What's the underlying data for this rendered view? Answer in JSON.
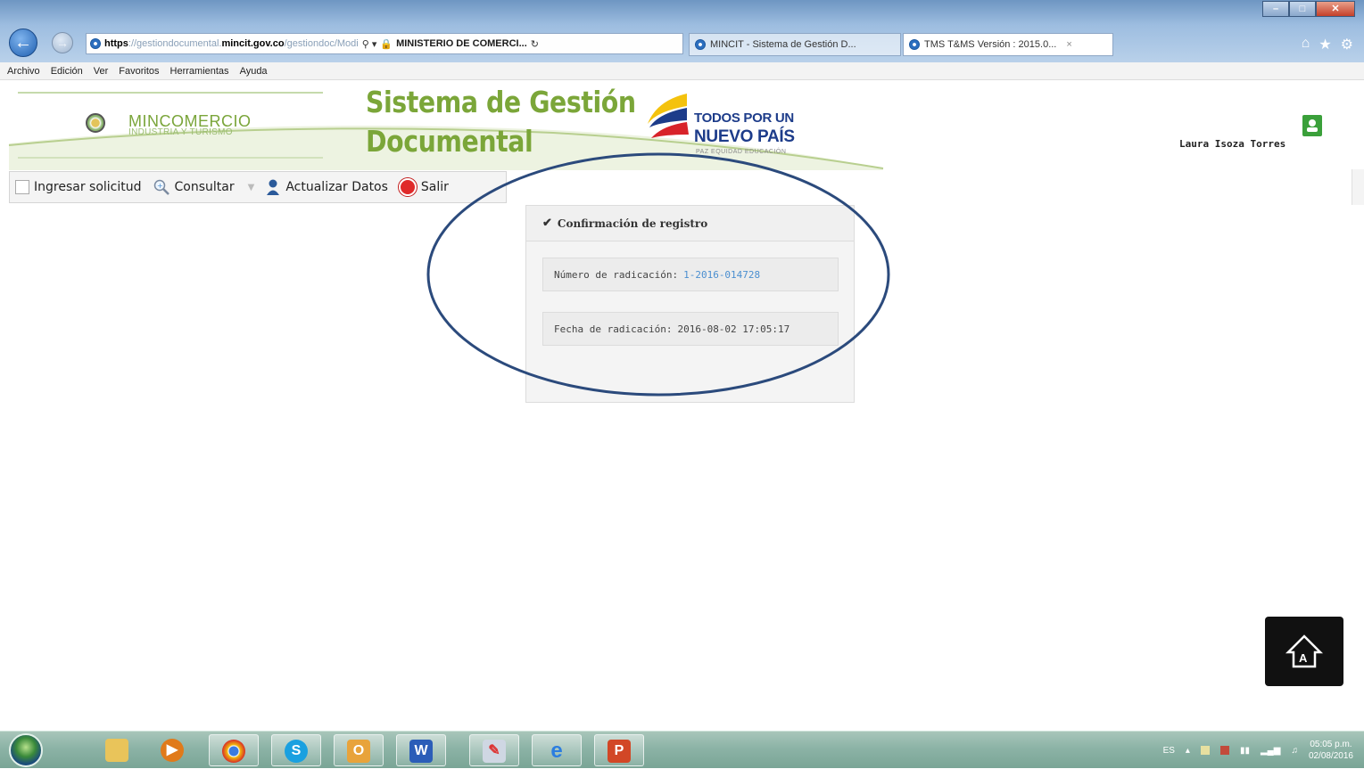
{
  "browser": {
    "url_scheme": "https",
    "url_pre": "://gestiondocumental.",
    "url_host": "mincit.gov.co",
    "url_post": "/gestiondoc/Modi",
    "site_identity": "MINISTERIO DE COMERCI...",
    "tabs": [
      {
        "label": "MINCIT - Sistema de Gestión D..."
      },
      {
        "label": "TMS T&MS Versión : 2015.0...",
        "close": "×"
      }
    ],
    "menu": [
      "Archivo",
      "Edición",
      "Ver",
      "Favoritos",
      "Herramientas",
      "Ayuda"
    ]
  },
  "header": {
    "ministry_name": "MINCOMERCIO",
    "ministry_sub": "INDUSTRIA Y TURISMO",
    "title_line1": "Sistema de Gestión",
    "title_line2": "Documental",
    "gov_line1": "TODOS POR UN",
    "gov_line2": "NUEVO PAÍS",
    "gov_line3": "PAZ   EQUIDAD   EDUCACIÓN",
    "user_name": "Laura Isoza Torres"
  },
  "toolbar": {
    "ingresar": "Ingresar solicitud",
    "consultar": "Consultar",
    "actualizar": "Actualizar Datos",
    "salir": "Salir"
  },
  "panel": {
    "title": "Confirmación de registro",
    "radicacion_label": "Número de radicación:",
    "radicacion_value": "1-2016-014728",
    "fecha_label": "Fecha de radicación:",
    "fecha_value": "2016-08-02 17:05:17"
  },
  "taskbar": {
    "language": "ES",
    "time": "05:05 p.m.",
    "date": "02/08/2016"
  },
  "colors": {
    "brand_green": "#7ba639",
    "gov_blue": "#1d3c8a",
    "link_blue": "#4b8fd0",
    "annotation_ellipse": "#2b4a7c"
  }
}
